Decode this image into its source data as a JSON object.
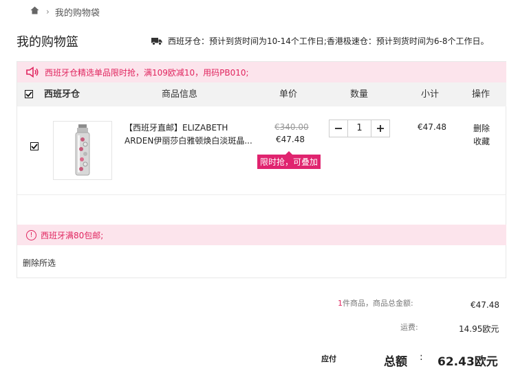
{
  "breadcrumb": {
    "current": "我的购物袋"
  },
  "page_title": "我的购物篮",
  "shipping_note": "西班牙仓：预计到货时间为10-14个工作日;香港极速仓：预计到货时间为6-8个工作日。",
  "promo_bar": {
    "text": "西班牙仓精选单品限时抢，满109欧减10，用码PB010;"
  },
  "table_header": {
    "warehouse": "西班牙仓",
    "product_info": "商品信息",
    "unit_price": "单价",
    "quantity": "数量",
    "subtotal": "小计",
    "actions": "操作"
  },
  "item": {
    "title_line1": "【西班牙直邮】ELIZABETH",
    "title_line2": "ARDEN伊丽莎白雅顿焕白淡斑晶...",
    "original_price": "€340.00",
    "price": "€47.48",
    "badge": "限时抢，可叠加",
    "quantity": "1",
    "subtotal": "€47.48",
    "delete": "删除",
    "favorite": "收藏"
  },
  "free_shipping": "西班牙满80包邮;",
  "delete_selected": "删除所选",
  "summary": {
    "count": "1",
    "count_suffix": "件商品，商品总金额:",
    "goods_total": "€47.48",
    "shipping_label": "运费:",
    "shipping_value": "14.95欧元",
    "payable_label": "应付",
    "total_label": "总额",
    "total_colon": ":",
    "total_value": "62.43欧元"
  },
  "colors": {
    "accent": "#e0245e",
    "badge": "#e0246f",
    "promo_bg": "#fce4ec",
    "header_bg": "#f2f2f2"
  }
}
